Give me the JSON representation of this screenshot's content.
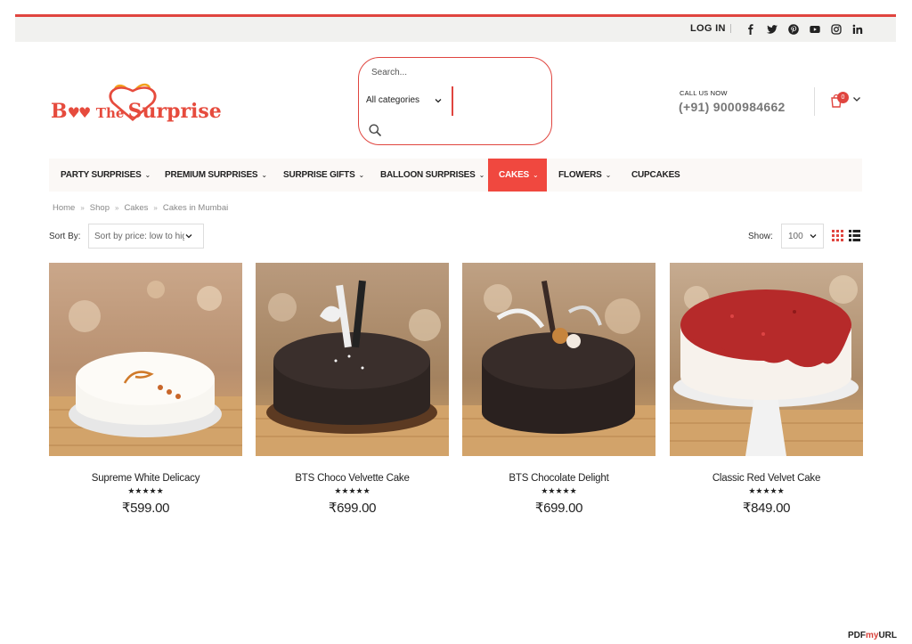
{
  "topbar": {
    "login_label": "LOG IN",
    "socials": [
      "facebook-icon",
      "twitter-icon",
      "pinterest-icon",
      "youtube-icon",
      "instagram-icon",
      "linkedin-icon"
    ]
  },
  "header": {
    "logo_text": "Book The Surprise",
    "logo_left": "B",
    "logo_mid": "The",
    "logo_right": "Surprise",
    "search_placeholder": "Search...",
    "search_category": "All categories",
    "call_label": "CALL US NOW",
    "call_number": "(+91) 9000984662",
    "cart_count": "0"
  },
  "nav": {
    "items": [
      {
        "label": "PARTY SURPRISES",
        "has_dropdown": true
      },
      {
        "label": "PREMIUM SURPRISES",
        "has_dropdown": true
      },
      {
        "label": "SURPRISE GIFTS",
        "has_dropdown": true
      },
      {
        "label": "BALLOON SURPRISES",
        "has_dropdown": true
      },
      {
        "label": "CAKES",
        "has_dropdown": true,
        "active": true
      },
      {
        "label": "FLOWERS",
        "has_dropdown": true
      },
      {
        "label": "CUPCAKES",
        "has_dropdown": false
      }
    ],
    "chevron": "⌄"
  },
  "breadcrumb": {
    "items": [
      "Home",
      "Shop",
      "Cakes",
      "Cakes in Mumbai"
    ],
    "separator": "»"
  },
  "toolbar": {
    "sort_label": "Sort By:",
    "sort_value": "Sort by price: low to high",
    "show_label": "Show:",
    "show_value": "100"
  },
  "products": [
    {
      "name": "Supreme White Delicacy",
      "rating": "★★★★★",
      "price": "₹599.00"
    },
    {
      "name": "BTS Choco Velvette Cake",
      "rating": "★★★★★",
      "price": "₹699.00"
    },
    {
      "name": "BTS Chocolate Delight",
      "rating": "★★★★★",
      "price": "₹699.00"
    },
    {
      "name": "Classic Red Velvet Cake",
      "rating": "★★★★★",
      "price": "₹849.00"
    }
  ],
  "watermark": {
    "pre": "PDF",
    "mid": "my",
    "post": "URL"
  },
  "colors": {
    "accent": "#e0453f",
    "topbar_bg": "#f1f1ef",
    "nav_bg": "#fbf8f6",
    "nav_active_bg": "#f0483f"
  }
}
